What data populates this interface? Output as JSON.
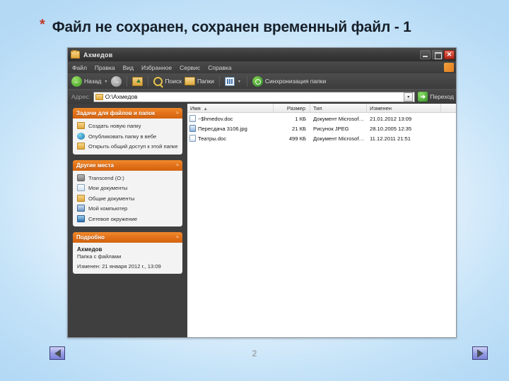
{
  "slide": {
    "bullet": "*",
    "title": "Файл не сохранен, сохранен временный файл - 1",
    "page_number": "2",
    "nav": {
      "prev_label": "◀",
      "next_label": "▶"
    },
    "colors": {
      "accent_orange": "#e2711a",
      "bullet_red": "#c0392b",
      "background_blue": "#b3d9f5"
    }
  },
  "window": {
    "title": "Ахмедов",
    "buttons": {
      "minimize": "_",
      "maximize": "□",
      "close": "✕"
    },
    "menu": [
      {
        "label": "Файл"
      },
      {
        "label": "Правка"
      },
      {
        "label": "Вид"
      },
      {
        "label": "Избранное"
      },
      {
        "label": "Сервис"
      },
      {
        "label": "Справка"
      }
    ],
    "toolbar": {
      "back_label": "Назад",
      "search_label": "Поиск",
      "folders_label": "Папки",
      "sync_label": "Синхронизация папки",
      "dropdown_caret": "▾"
    },
    "address": {
      "label": "Адрес:",
      "value": "O:\\Ахмедов",
      "dropdown_caret": "▾",
      "go_label": "Переход",
      "go_arrow": "➜"
    }
  },
  "sidebar": {
    "panels": [
      {
        "title": "Задачи для файлов и папок",
        "collapse_icon": "≈",
        "items": [
          {
            "icon": "folder",
            "label": "Создать новую папку"
          },
          {
            "icon": "globe",
            "label": "Опубликовать папку в вебе"
          },
          {
            "icon": "shared",
            "label": "Открыть общий доступ к этой папке"
          }
        ]
      },
      {
        "title": "Другие места",
        "collapse_icon": "≈",
        "items": [
          {
            "icon": "drive",
            "label": "Transcend (O:)"
          },
          {
            "icon": "doc",
            "label": "Мои документы"
          },
          {
            "icon": "sharedoc",
            "label": "Общие документы"
          },
          {
            "icon": "pc",
            "label": "Мой компьютер"
          },
          {
            "icon": "net",
            "label": "Сетевое окружение"
          }
        ]
      },
      {
        "title": "Подробно",
        "collapse_icon": "≈",
        "detail": {
          "name": "Ахмедов",
          "subtitle": "Папка с файлами",
          "modified": "Изменен: 21 января 2012 г., 13:09"
        }
      }
    ]
  },
  "filelist": {
    "columns": [
      {
        "key": "name",
        "label": "Имя",
        "sort": "▲"
      },
      {
        "key": "size",
        "label": "Размер"
      },
      {
        "key": "type",
        "label": "Тип"
      },
      {
        "key": "mod",
        "label": "Изменен"
      }
    ],
    "rows": [
      {
        "icon": "word",
        "name": "~$hmedov.doc",
        "size": "1 КБ",
        "type": "Документ Microsof…",
        "mod": "21.01.2012 13:09"
      },
      {
        "icon": "jpeg",
        "name": "Пересдача 3106.jpg",
        "size": "21 КБ",
        "type": "Рисунок JPEG",
        "mod": "28.10.2005 12:35"
      },
      {
        "icon": "word",
        "name": "Театры.doc",
        "size": "499 КБ",
        "type": "Документ Microsof…",
        "mod": "11.12.2011 21:51"
      }
    ]
  }
}
